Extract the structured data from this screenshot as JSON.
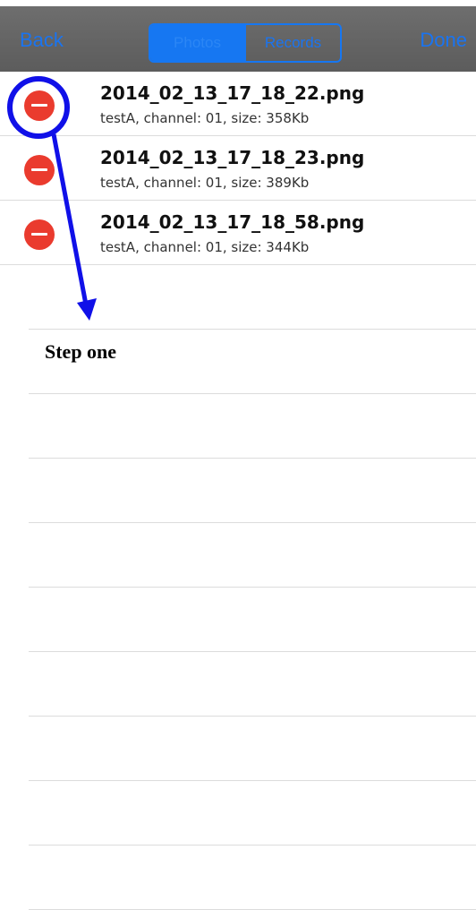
{
  "navbar": {
    "back_label": "Back",
    "done_label": "Done",
    "segments": [
      "Photos",
      "Records"
    ],
    "selected_segment": "Photos"
  },
  "files": [
    {
      "name": "2014_02_13_17_18_22.png",
      "meta": "testA, channel: 01, size: 358Kb"
    },
    {
      "name": "2014_02_13_17_18_23.png",
      "meta": "testA, channel: 01, size: 389Kb"
    },
    {
      "name": "2014_02_13_17_18_58.png",
      "meta": "testA, channel: 01, size: 344Kb"
    }
  ],
  "annotation": {
    "step_text": "Step one",
    "color": "#1010e8"
  },
  "colors": {
    "accent": "#1677f2",
    "delete": "#ea3b2e",
    "navbar": "#666666"
  }
}
